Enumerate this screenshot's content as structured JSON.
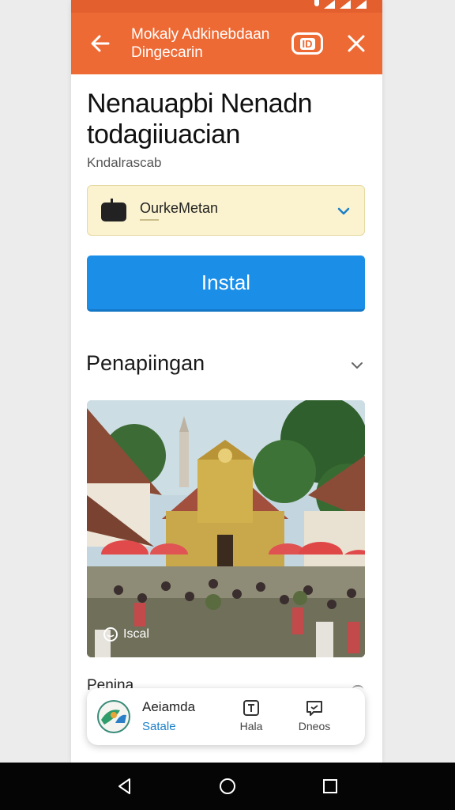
{
  "appbar": {
    "title_line1": "Mokaly Adkinebdaan",
    "title_line2": "Dingecarin",
    "badge_label": "ID"
  },
  "content": {
    "headline": "Nenauapbi Nenadn todagiiuacian",
    "subtext": "Kndalrascab",
    "select": {
      "value": "OurkeMetan"
    },
    "install_label": "Instal",
    "section_title": "Penapiingan",
    "photo_caption": "Iscal",
    "peek_label": "Penina"
  },
  "bottom_card": {
    "app_name": "Aeiamda",
    "app_sub": "Satale",
    "actions": [
      {
        "label": "Hala",
        "icon": "info-box-icon"
      },
      {
        "label": "Dneos",
        "icon": "message-icon"
      }
    ]
  },
  "colors": {
    "appbar": "#ee6a35",
    "install": "#1b8fe8",
    "select_bg": "#fbf3cf"
  }
}
